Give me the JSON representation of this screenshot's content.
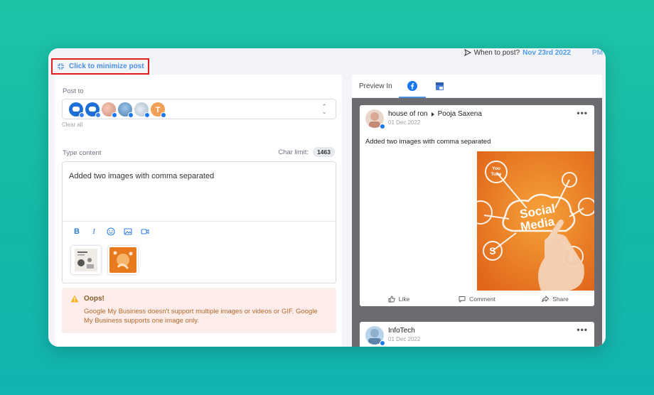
{
  "header": {
    "when_label": "When to post?",
    "when_date": "Nov 23rd 2022",
    "when_time": "PM",
    "minimize_label": "Click to minimize post"
  },
  "compose": {
    "post_to_label": "Post to",
    "clear_all": "Clear all",
    "type_content_label": "Type content",
    "char_limit_label": "Char limit:",
    "char_count": "1463",
    "content": "Added two images with comma separated",
    "toolbar_icons": [
      "bold-icon",
      "italic-icon",
      "emoji-icon",
      "image-icon",
      "video-icon"
    ],
    "alert_title": "Oops!",
    "alert_message": "Google My Business doesn't support multiple images or videos or GIF. Google My Business supports one image only."
  },
  "preview": {
    "label": "Preview In",
    "posts": [
      {
        "author": "house of ron",
        "target": "Pooja Saxena",
        "date": "01 Dec 2022",
        "text": "Added two images with comma separated",
        "actions": [
          "Like",
          "Comment",
          "Share"
        ]
      },
      {
        "author": "InfoTech",
        "date": "01 Dec 2022"
      }
    ]
  },
  "image_text": {
    "headline": "Social Media",
    "icon": "You Tube"
  },
  "colors": {
    "accent": "#4a90e2",
    "highlight_border": "#e11d1d",
    "facebook": "#1877f2",
    "alert_bg": "#fcecea"
  }
}
